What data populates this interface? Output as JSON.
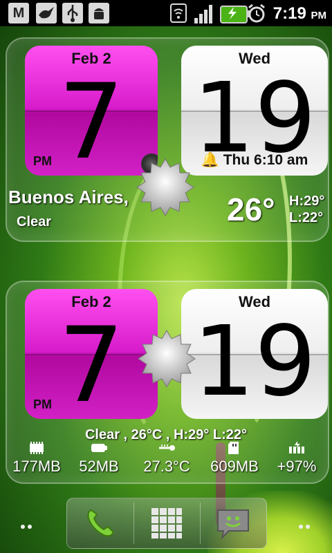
{
  "status_bar": {
    "time": "7:19",
    "ampm": "PM",
    "left_icons": [
      "gmail-icon",
      "bird-icon",
      "usb-icon",
      "android-debug-icon"
    ],
    "right_icons": [
      "wifi-icon",
      "signal-icon",
      "battery-charging-icon",
      "alarm-icon"
    ]
  },
  "widget1": {
    "date": "Feb  2",
    "hour": "7",
    "ampm": "PM",
    "day": "Wed",
    "minute": "19",
    "alarm": "Thu 6:10 am",
    "city": "Buenos Aires,",
    "condition": "Clear",
    "temperature": "26°",
    "high": "H:29°",
    "low": "L:22°"
  },
  "widget2": {
    "date": "Feb  2",
    "hour": "7",
    "ampm": "PM",
    "day": "Wed",
    "minute": "19",
    "summary": "Clear , 26°C , H:29° L:22°",
    "stats": [
      {
        "icon": "ram-chip-icon",
        "value": "177MB"
      },
      {
        "icon": "battery-icon",
        "value": "52MB"
      },
      {
        "icon": "thermometer-icon",
        "value": "27.3°C"
      },
      {
        "icon": "sd-card-icon",
        "value": "609MB"
      },
      {
        "icon": "battery-charge-icon",
        "value": "+97%"
      }
    ]
  },
  "dock": {
    "items": [
      "phone-icon",
      "app-drawer-icon",
      "messaging-icon"
    ]
  },
  "colors": {
    "pink_flip": "#d71ccb",
    "white_flip": "#eeeeee",
    "status_bar": "#000000"
  }
}
